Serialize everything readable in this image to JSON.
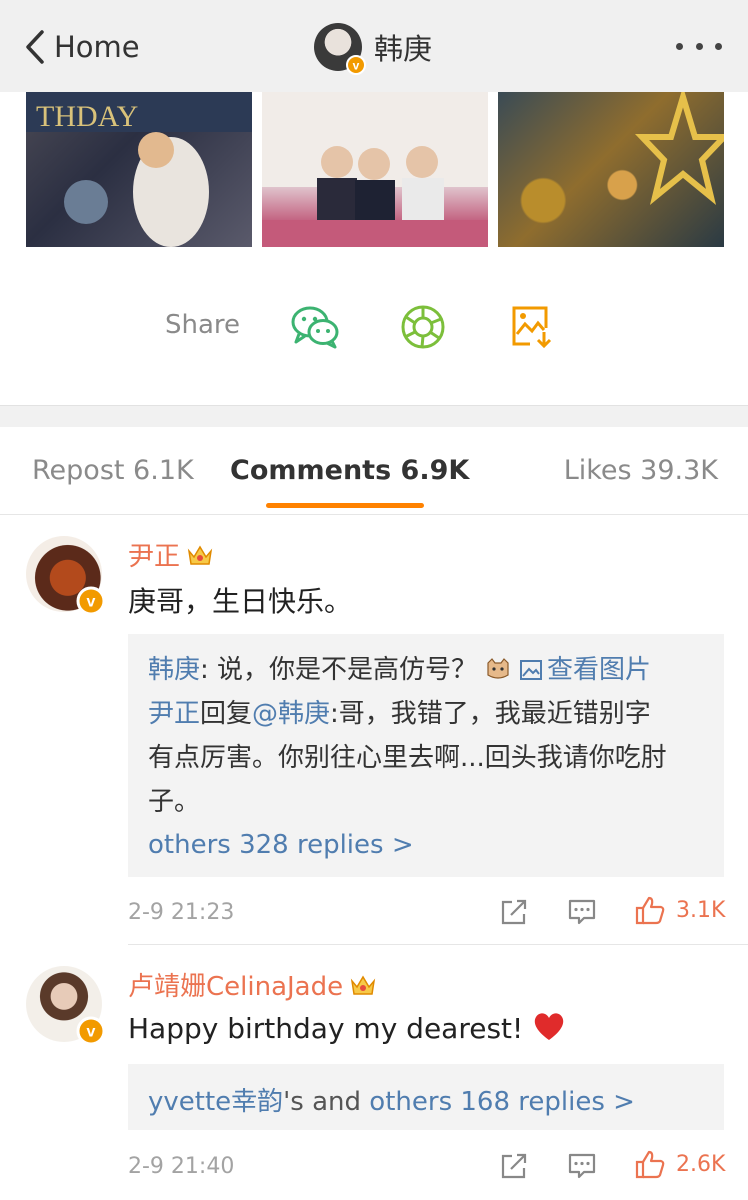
{
  "nav": {
    "back_label": "Home",
    "title": "韩庚"
  },
  "share": {
    "label": "Share"
  },
  "tabs": {
    "repost": "Repost 6.1K",
    "comments": "Comments 6.9K",
    "likes": "Likes 39.3K"
  },
  "comments": [
    {
      "username": "尹正",
      "text": "庚哥，生日快乐。",
      "replies": {
        "line1_author": "韩庚",
        "line1_text": ": 说，你是不是高仿号？",
        "line1_link": "查看图片",
        "line2_author": "尹正",
        "line2_mid": "回复",
        "line2_mention": "@韩庚",
        "line2_text": ":哥，我错了，我最近错别字",
        "line3_text": "有点厉害。你别往心里去啊...回头我请你吃肘",
        "line4_text": "子。",
        "more": "others 328 replies >"
      },
      "time": "2-9 21:23",
      "likes": "3.1K"
    },
    {
      "username": "卢靖姗CelinaJade",
      "text": "Happy birthday my dearest!",
      "replies": {
        "lead_name": "yvette幸韵",
        "lead_mid": "'s and ",
        "more": "others 168 replies >"
      },
      "time": "2-9 21:40",
      "likes": "2.6K"
    }
  ],
  "colors": {
    "accent": "#ff8200",
    "username": "#eb7350",
    "link": "#507daf",
    "wechat": "#3cb371",
    "moments": "#7cbf3b"
  }
}
